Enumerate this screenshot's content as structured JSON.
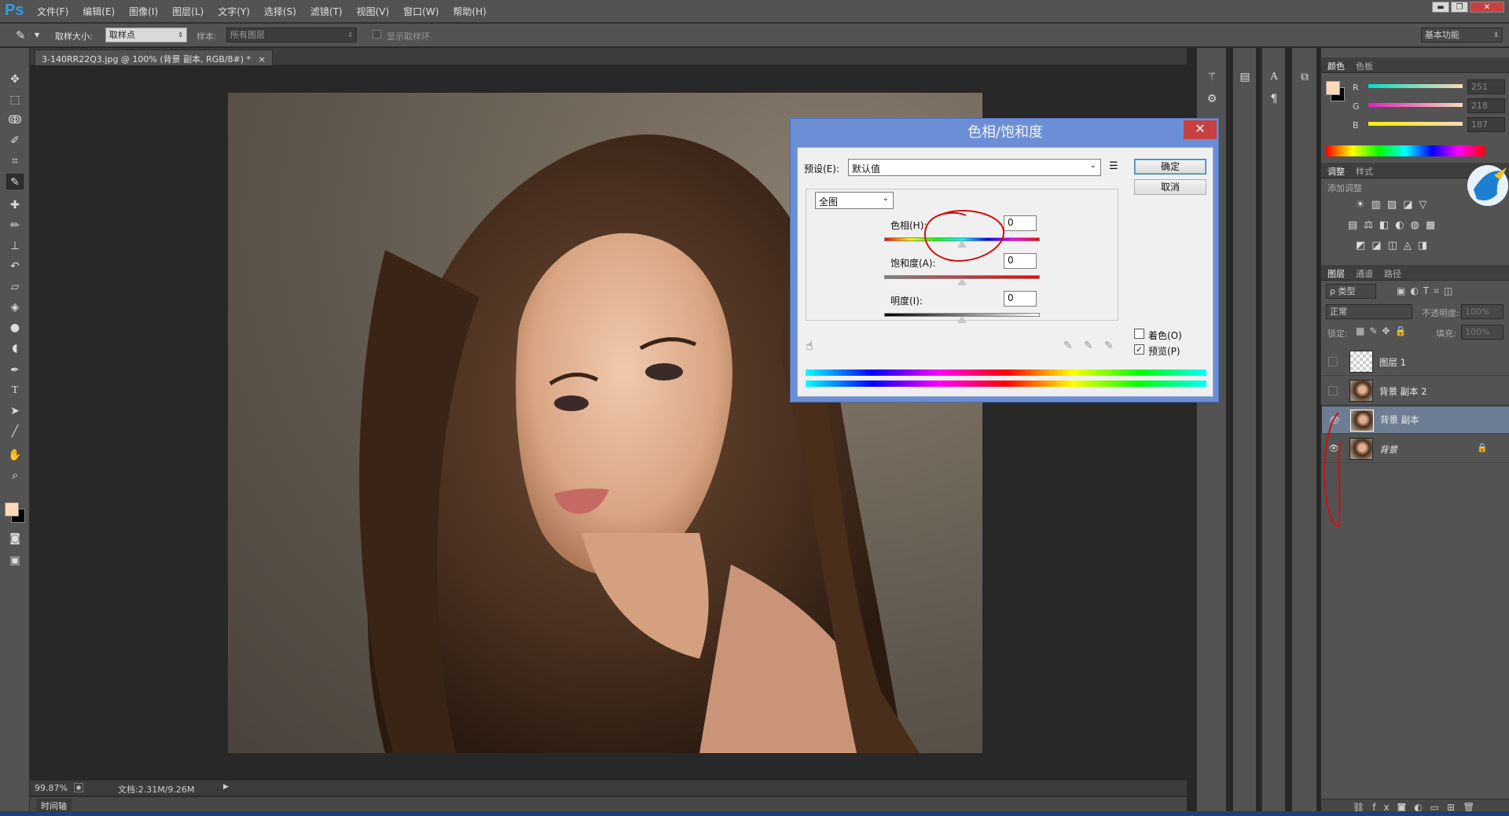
{
  "app": {
    "logo": "Ps"
  },
  "menu": [
    "文件(F)",
    "编辑(E)",
    "图像(I)",
    "图层(L)",
    "文字(Y)",
    "选择(S)",
    "滤镜(T)",
    "视图(V)",
    "窗口(W)",
    "帮助(H)"
  ],
  "options": {
    "sample_size_label": "取样大小:",
    "sample_size_value": "取样点",
    "sample_label": "样本:",
    "sample_value": "所有图层",
    "show_ring_label": "显示取样环",
    "workspace": "基本功能"
  },
  "document": {
    "tab_title": "3-140RR22Q3.jpg @ 100% (背景 副本, RGB/8#) *",
    "tab_close": "×"
  },
  "status": {
    "zoom": "99.87%",
    "doc_info": "文档:2.31M/9.26M",
    "timeline": "时间轴"
  },
  "color_panel": {
    "tabs": [
      "颜色",
      "色板"
    ],
    "channels": [
      {
        "label": "R",
        "value": "251",
        "color": "#e84040"
      },
      {
        "label": "G",
        "value": "218",
        "color": "#e040e0"
      },
      {
        "label": "B",
        "value": "187",
        "color": "#e0e040"
      }
    ],
    "foreground": "#fbdabb",
    "background": "#000000"
  },
  "adjust_panel": {
    "tabs": [
      "调整",
      "样式"
    ],
    "subtitle": "添加调整"
  },
  "layers_panel": {
    "tabs": [
      "图层",
      "通道",
      "路径"
    ],
    "filter_label": "ρ 类型",
    "blend_mode": "正常",
    "opacity_label": "不透明度:",
    "opacity_value": "100%",
    "lock_label": "锁定:",
    "fill_label": "填充:",
    "fill_value": "100%",
    "layers": [
      {
        "name": "图层 1",
        "visible": false,
        "selected": false,
        "kind": "transparent",
        "locked": false
      },
      {
        "name": "背景 副本 2",
        "visible": false,
        "selected": false,
        "kind": "photo",
        "locked": false
      },
      {
        "name": "背景 副本",
        "visible": true,
        "selected": true,
        "kind": "photo",
        "locked": false
      },
      {
        "name": "背景",
        "visible": true,
        "selected": false,
        "kind": "photo",
        "locked": true
      }
    ]
  },
  "dialog": {
    "title": "色相/饱和度",
    "close": "✕",
    "preset_label": "预设(E):",
    "preset_value": "默认值",
    "ok": "确定",
    "cancel": "取消",
    "range_value": "全图",
    "hue_label": "色相(H):",
    "hue_value": "0",
    "saturation_label": "饱和度(A):",
    "saturation_value": "0",
    "lightness_label": "明度(I):",
    "lightness_value": "0",
    "colorize_label": "着色(O)",
    "preview_label": "预览(P)",
    "colorize_checked": false,
    "preview_checked": true
  },
  "icons": {
    "eyedropper": "eyedropper-icon",
    "move": "move-icon",
    "hand": "hand-icon",
    "zoom": "zoom-icon",
    "eye": "eye-icon",
    "lock": "lock-icon"
  }
}
